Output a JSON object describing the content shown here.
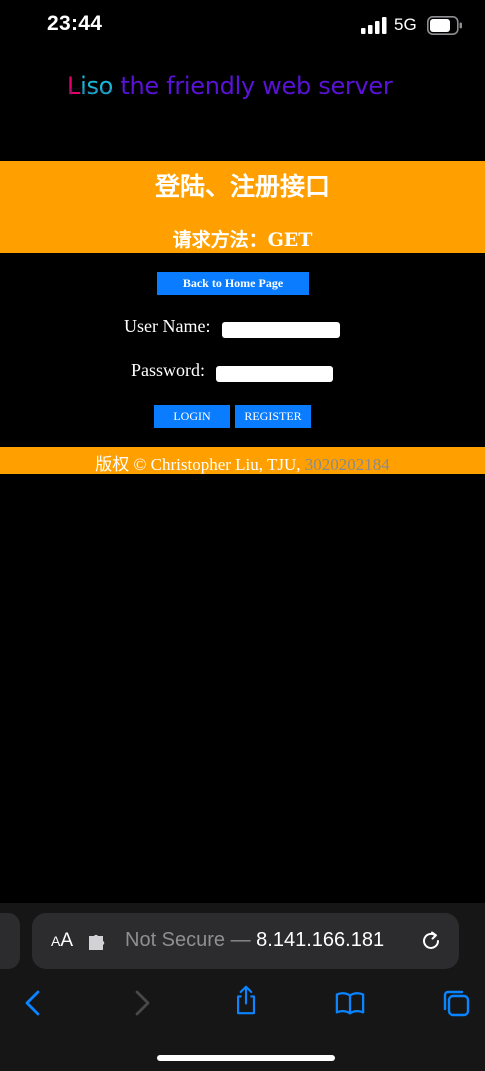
{
  "status_bar": {
    "time": "23:44",
    "network": "5G",
    "icons": [
      "signal-bars-icon",
      "battery-icon"
    ]
  },
  "header": {
    "logo_l": "L",
    "logo_iso": "iso",
    "logo_rest": " the friendly web server",
    "logo_colors": {
      "l": "#e5006a",
      "iso": "#19b6d6",
      "rest": "#5a12d8"
    }
  },
  "banner": {
    "title": "登陆、注册接口",
    "method": "请求方法：GET",
    "color": "#ffa000"
  },
  "form": {
    "home_button": "Back to Home Page",
    "username_label": "User Name:",
    "username_value": "",
    "password_label": "Password:",
    "password_value": "",
    "login_button": "LOGIN",
    "register_button": "REGISTER",
    "button_color": "#0a7cff"
  },
  "footer": {
    "text": "版权 © Christopher Liu, TJU, ",
    "id": "3020202184"
  },
  "browser": {
    "aa_small": "A",
    "aa_big": "A",
    "security": "Not Secure — ",
    "host": "8.141.166.181",
    "icons": [
      "extension-icon",
      "reload-icon",
      "back-icon",
      "forward-icon",
      "share-icon",
      "bookmarks-icon",
      "tabs-icon"
    ]
  }
}
